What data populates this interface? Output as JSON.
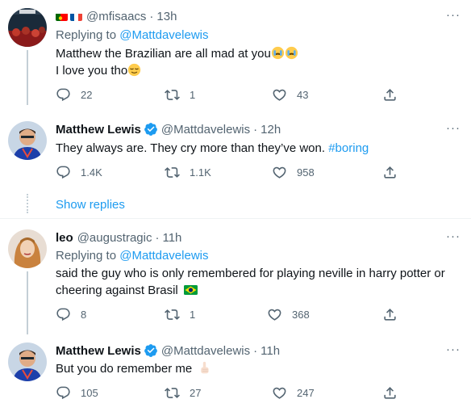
{
  "tweets": [
    {
      "handle": "@mfisaacs",
      "time": "13h",
      "reply_prefix": "Replying to",
      "reply_to": "@Mattdavelewis",
      "line1": "Matthew the Brazilian are all mad at you",
      "line2": "I love you tho",
      "replies": "22",
      "retweets": "1",
      "likes": "43"
    },
    {
      "name": "Matthew Lewis",
      "handle": "@Mattdavelewis",
      "time": "12h",
      "text": "They always are. They cry more than they’ve won.",
      "hashtag": "#boring",
      "replies": "1.4K",
      "retweets": "1.1K",
      "likes": "958"
    },
    {
      "name": "leo",
      "handle": "@augustragic",
      "time": "11h",
      "reply_prefix": "Replying to",
      "reply_to": "@Mattdavelewis",
      "line1": "said the guy who is only remembered for playing neville in harry potter or",
      "line2": "cheering against Brasil",
      "replies": "8",
      "retweets": "1",
      "likes": "368"
    },
    {
      "name": "Matthew Lewis",
      "handle": "@Mattdavelewis",
      "time": "11h",
      "text": "But you do remember me",
      "replies": "105",
      "retweets": "27",
      "likes": "247"
    }
  ],
  "show_replies": "Show replies",
  "separator": "·",
  "more": "···",
  "icons": {
    "reply": "reply-icon",
    "retweet": "retweet-icon",
    "like": "heart-icon",
    "share": "share-icon",
    "verified": "verified-badge-icon"
  },
  "colors": {
    "link": "#1d9bf0",
    "muted": "#536471",
    "text": "#0f1419",
    "thread_line": "#c4cfd6"
  }
}
